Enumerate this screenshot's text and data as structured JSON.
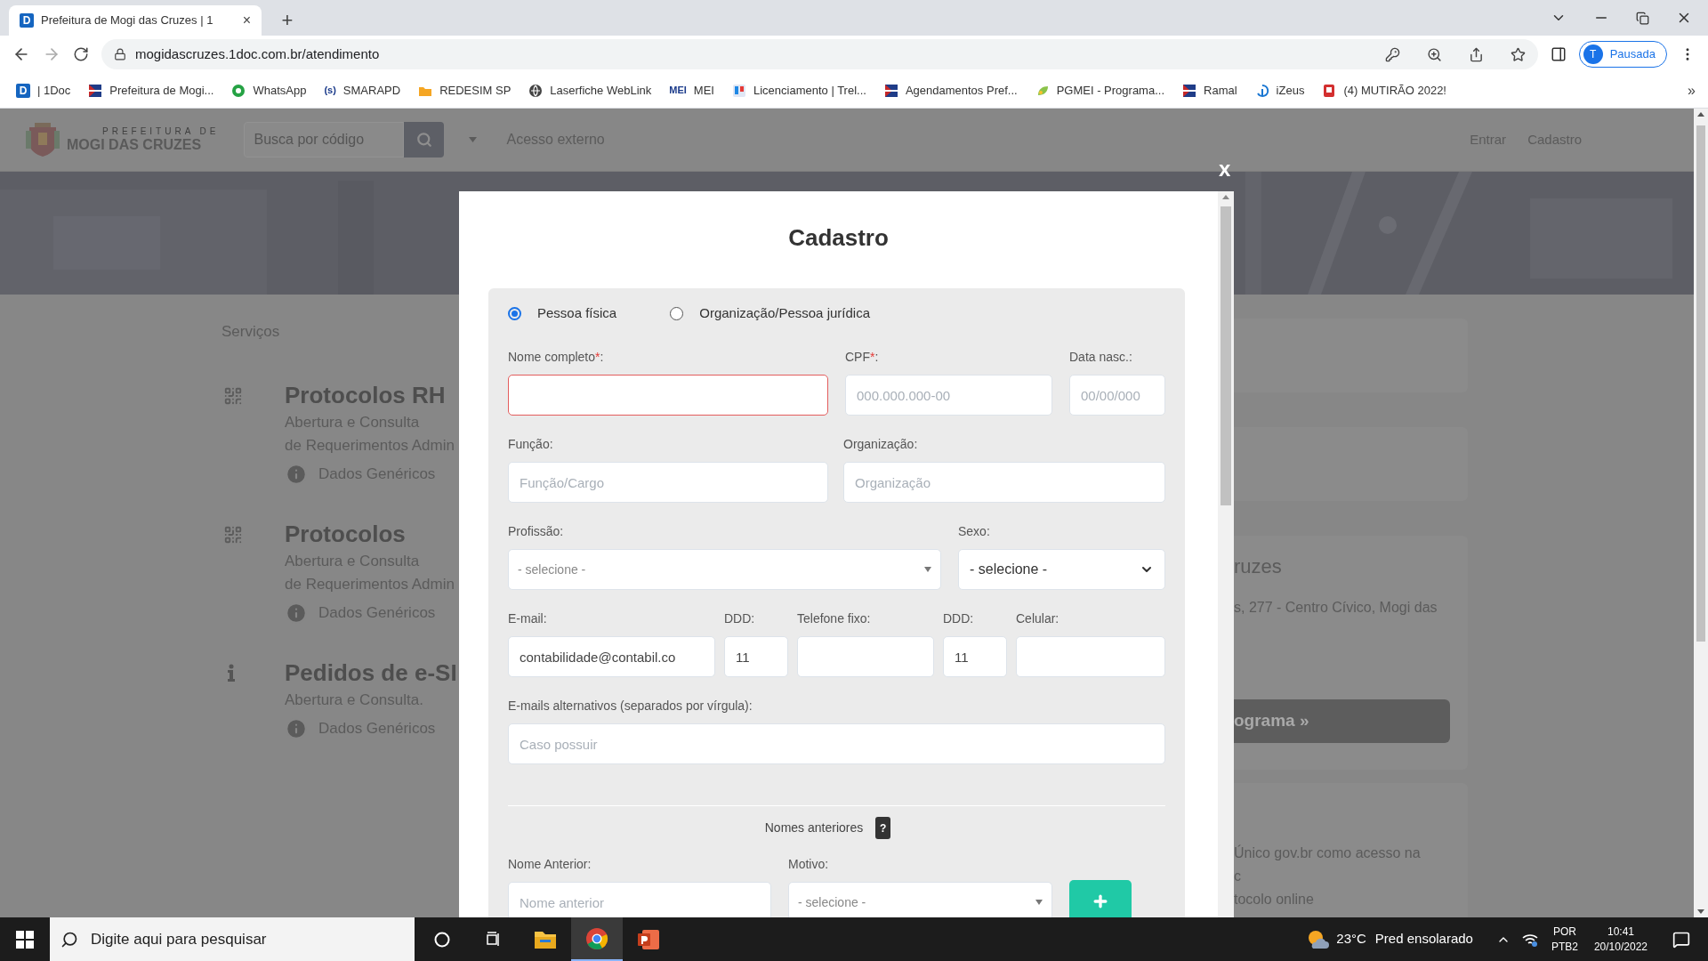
{
  "browser": {
    "tab": {
      "icon_text": "D",
      "title": "Prefeitura de Mogi das Cruzes | 1",
      "close": "×"
    },
    "new_tab": "+",
    "url": "mogidascruzes.1doc.com.br/atendimento",
    "profile": {
      "initial": "T",
      "label": "Pausada"
    },
    "bookmarks": [
      {
        "kind": "doc",
        "icon_text": "D",
        "label": "| 1Doc"
      },
      {
        "kind": "flag",
        "label": "Prefeitura de Mogi..."
      },
      {
        "kind": "whatsapp",
        "label": "WhatsApp"
      },
      {
        "kind": "text",
        "icon_text": "(s)",
        "label": "SMARAPD"
      },
      {
        "kind": "folder",
        "label": "REDESIM SP"
      },
      {
        "kind": "globe",
        "label": "Laserfiche WebLink"
      },
      {
        "kind": "text",
        "icon_text": "MEI",
        "label": "MEI"
      },
      {
        "kind": "board",
        "label": "Licenciamento | Trel..."
      },
      {
        "kind": "flag",
        "label": "Agendamentos Pref..."
      },
      {
        "kind": "leaf",
        "label": "PGMEI - Programa..."
      },
      {
        "kind": "flag",
        "label": "Ramal"
      },
      {
        "kind": "swirl",
        "label": "iZeus"
      },
      {
        "kind": "badge",
        "label": "(4) MUTIRÃO 2022!"
      }
    ],
    "bookmarks_more": "»"
  },
  "site": {
    "logo": {
      "top": "PREFEITURA DE",
      "name": "MOGI DAS CRUZES"
    },
    "search_placeholder": "Busca por código",
    "external": "Acesso externo",
    "nav": [
      "Entrar",
      "Cadastro"
    ],
    "section": "Serviços",
    "services": [
      {
        "kind": "grid",
        "title": "Protocolos RH",
        "lines": [
          "Abertura e Consulta",
          "de Requerimentos Admin"
        ],
        "link": "Dados Genéricos"
      },
      {
        "kind": "grid",
        "title": "Protocolos",
        "lines": [
          "Abertura e Consulta",
          "de Requerimentos Admin"
        ],
        "link": "Dados Genéricos"
      },
      {
        "kind": "info",
        "title": "Pedidos de e-SI",
        "lines": [
          "Abertura e Consulta."
        ],
        "link": "Dados Genéricos"
      }
    ],
    "cards": [
      {
        "kind": "empty"
      },
      {
        "kind": "empty"
      },
      {
        "kind": "contact",
        "title": "ruzes",
        "text": "s, 277 - Centro Cívico, Mogi das",
        "button": "ograma »"
      },
      {
        "kind": "info",
        "lines": [
          "Único gov.br como acesso na",
          "c",
          "tocolo online"
        ]
      }
    ]
  },
  "modal": {
    "title": "Cadastro",
    "close": "x",
    "person_types": [
      {
        "label": "Pessoa física",
        "selected": true
      },
      {
        "label": "Organização/Pessoa jurídica",
        "selected": false
      }
    ],
    "sections": [
      {
        "fields": [
          {
            "kind": "input",
            "label": "Nome completo",
            "required_mark": "*",
            "colon": ":",
            "invalid": true
          },
          {
            "kind": "input",
            "label": "CPF",
            "required_mark": "*",
            "colon": ":",
            "placeholder": "000.000.000-00",
            "invalid": false
          },
          {
            "kind": "input",
            "label": "Data nasc.:",
            "placeholder": "00/00/000",
            "invalid": false
          }
        ]
      },
      {
        "fields": [
          {
            "kind": "input",
            "label": "Função:",
            "placeholder": "Função/Cargo",
            "invalid": false
          },
          {
            "kind": "input",
            "label": "Organização:",
            "placeholder": "Organização",
            "invalid": false
          }
        ]
      },
      {
        "fields": [
          {
            "kind": "select",
            "label": "Profissão:",
            "value": "- selecione -"
          },
          {
            "kind": "native_select",
            "label": "Sexo:",
            "value": "- selecione -"
          }
        ]
      },
      {
        "fields": [
          {
            "kind": "input",
            "label": "E-mail:",
            "value": "contabilidade@contabil.co",
            "invalid": false
          },
          {
            "kind": "input",
            "label": "DDD:",
            "value": "11",
            "invalid": false
          },
          {
            "kind": "input",
            "label": "Telefone fixo:",
            "invalid": false
          },
          {
            "kind": "input",
            "label": "DDD:",
            "value": "11",
            "invalid": false
          },
          {
            "kind": "input",
            "label": "Celular:",
            "invalid": false
          }
        ]
      },
      {
        "fields": [
          {
            "kind": "input",
            "label": "E-mails alternativos (separados por vírgula):",
            "placeholder": "Caso possuir",
            "invalid": false
          }
        ]
      }
    ],
    "previous_names": {
      "title": "Nomes anteriores",
      "help": "?",
      "fields": [
        {
          "kind": "input",
          "label": "Nome Anterior:",
          "placeholder": "Nome anterior",
          "invalid": false
        },
        {
          "kind": "select",
          "label": "Motivo:",
          "value": "- selecione -"
        }
      ]
    }
  },
  "taskbar": {
    "search_placeholder": "Digite aqui para pesquisar",
    "apps": [
      {
        "kind": "cortana",
        "selected": false
      },
      {
        "kind": "taskview",
        "selected": false
      },
      {
        "kind": "explorer",
        "selected": false
      },
      {
        "kind": "chrome",
        "selected": true
      },
      {
        "kind": "powerpoint",
        "selected": false
      }
    ],
    "weather": {
      "temp": "23°C",
      "text": "Pred ensolarado"
    },
    "language": [
      "POR",
      "PTB2"
    ],
    "time": "10:41",
    "date": "20/10/2022"
  }
}
